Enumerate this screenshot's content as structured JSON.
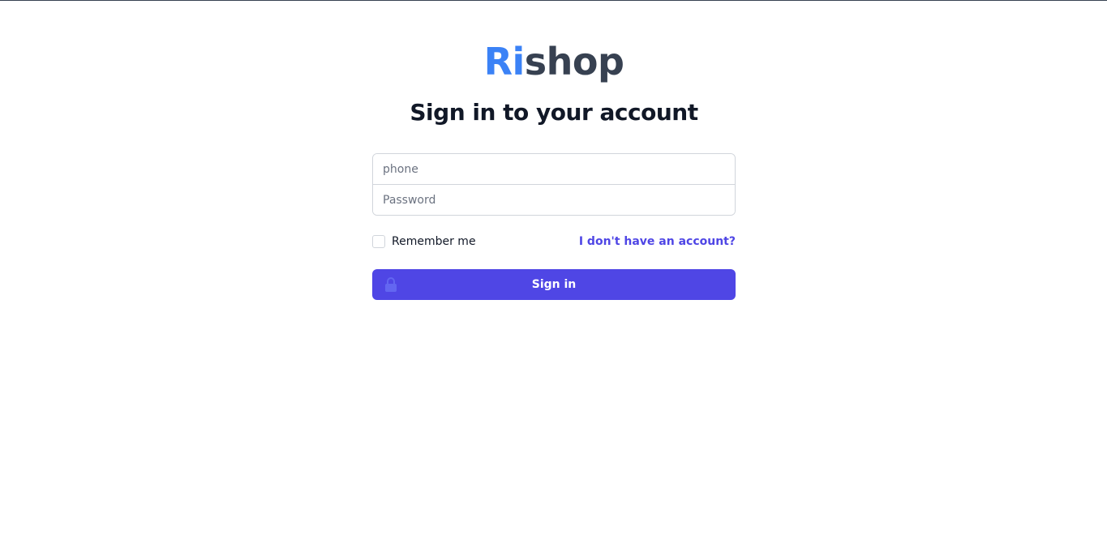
{
  "logo": {
    "part1": "Ri",
    "part2": "shop",
    "colors": {
      "part1": "#3b82f6",
      "part2": "#374151"
    }
  },
  "heading": "Sign in to your account",
  "form": {
    "phone_placeholder": "phone",
    "password_placeholder": "Password",
    "remember_label": "Remember me",
    "remember_checked": false,
    "no_account_link": "I don't have an account?",
    "submit_label": "Sign in",
    "submit_icon": "lock-icon"
  },
  "colors": {
    "accent": "#4f46e5",
    "lock_icon": "#6366f1"
  }
}
